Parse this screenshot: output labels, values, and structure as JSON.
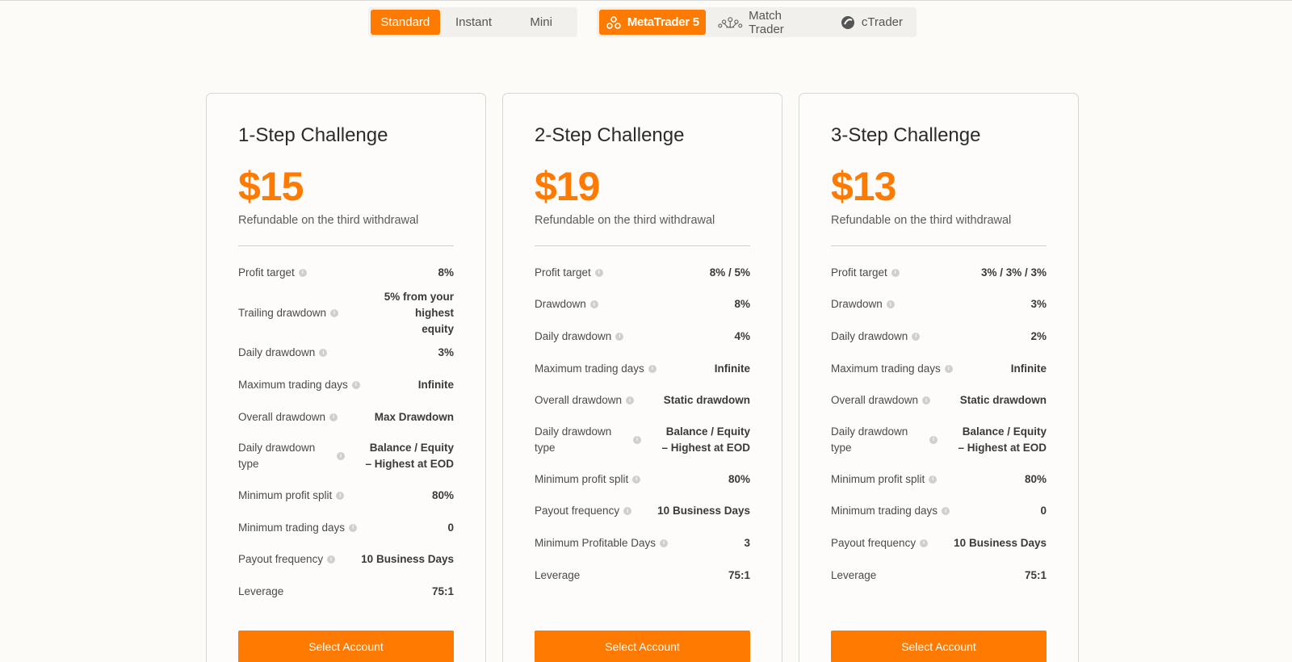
{
  "tabs_type": [
    {
      "label": "Standard",
      "active": true
    },
    {
      "label": "Instant",
      "active": false
    },
    {
      "label": "Mini",
      "active": false
    }
  ],
  "tabs_platform": [
    {
      "label": "MetaTrader 5",
      "icon": "metatrader-icon",
      "active": true
    },
    {
      "label": "Match Trader",
      "icon": "match-trader-icon",
      "active": false
    },
    {
      "label": "cTrader",
      "icon": "ctrader-icon",
      "active": false
    }
  ],
  "accent_color": "#ff7a00",
  "cards": [
    {
      "title": "1-Step Challenge",
      "price": "$15",
      "subtitle": "Refundable on the third withdrawal",
      "button": "Select Account",
      "rows": [
        {
          "label": "Profit target",
          "value": "8%"
        },
        {
          "label": "Trailing drawdown",
          "value": "5% from your highest equity"
        },
        {
          "label": "Daily drawdown",
          "value": "3%"
        },
        {
          "label": "Maximum trading days",
          "value": "Infinite"
        },
        {
          "label": "Overall drawdown",
          "value": "Max Drawdown"
        },
        {
          "label": "Daily drawdown type",
          "value": "Balance / Equity – Highest at EOD"
        },
        {
          "label": "Minimum profit split",
          "value": "80%"
        },
        {
          "label": "Minimum trading days",
          "value": "0"
        },
        {
          "label": "Payout frequency",
          "value": "10 Business Days"
        },
        {
          "label": "Leverage",
          "value": "75:1"
        }
      ]
    },
    {
      "title": "2-Step Challenge",
      "price": "$19",
      "subtitle": "Refundable on the third withdrawal",
      "button": "Select Account",
      "rows": [
        {
          "label": "Profit target",
          "value": "8% / 5%"
        },
        {
          "label": "Drawdown",
          "value": "8%"
        },
        {
          "label": "Daily drawdown",
          "value": "4%"
        },
        {
          "label": "Maximum trading days",
          "value": "Infinite"
        },
        {
          "label": "Overall drawdown",
          "value": "Static drawdown"
        },
        {
          "label": "Daily drawdown type",
          "value": "Balance / Equity – Highest at EOD"
        },
        {
          "label": "Minimum profit split",
          "value": "80%"
        },
        {
          "label": "Payout frequency",
          "value": "10 Business Days"
        },
        {
          "label": "Minimum Profitable Days",
          "value": "3"
        },
        {
          "label": "Leverage",
          "value": "75:1"
        }
      ]
    },
    {
      "title": "3-Step Challenge",
      "price": "$13",
      "subtitle": "Refundable on the third withdrawal",
      "button": "Select Account",
      "rows": [
        {
          "label": "Profit target",
          "value": "3% / 3% / 3%"
        },
        {
          "label": "Drawdown",
          "value": "3%"
        },
        {
          "label": "Daily drawdown",
          "value": "2%"
        },
        {
          "label": "Maximum trading days",
          "value": "Infinite"
        },
        {
          "label": "Overall drawdown",
          "value": "Static drawdown"
        },
        {
          "label": "Daily drawdown type",
          "value": "Balance / Equity – Highest at EOD"
        },
        {
          "label": "Minimum profit split",
          "value": "80%"
        },
        {
          "label": "Minimum trading days",
          "value": "0"
        },
        {
          "label": "Payout frequency",
          "value": "10 Business Days"
        },
        {
          "label": "Leverage",
          "value": "75:1"
        }
      ]
    }
  ]
}
